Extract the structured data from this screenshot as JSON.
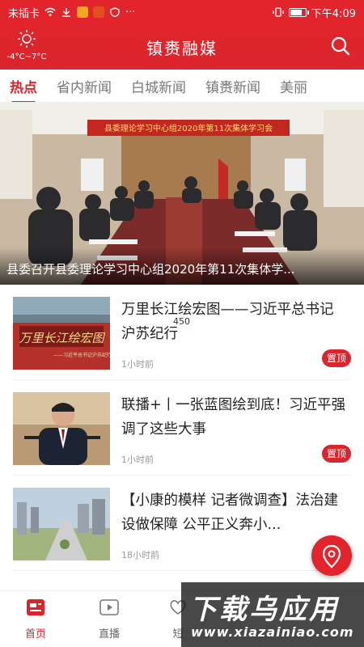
{
  "status_bar": {
    "carrier": "未插卡",
    "time": "下午4:09",
    "battery_percent": 85
  },
  "header": {
    "app_title": "镇赉融媒",
    "weather_temp": "-4°C~7°C",
    "weather_icon": "sun-icon",
    "search_icon": "search-icon"
  },
  "tabs": [
    "热点",
    "省内新闻",
    "白城新闻",
    "镇赉新闻",
    "美丽"
  ],
  "banner": {
    "caption": "县委召开县委理论学习中心组2020年第11次集体学...",
    "banner_text": "县委理论学习中心组2020年第11次集体学习会"
  },
  "articles": [
    {
      "title": "万里长江绘宏图——习近平总书记沪苏纪行",
      "time": "1小时前",
      "badge": "置顶",
      "thumb_text": "万里长江绘宏图",
      "thumb_sub": "——习近平总书记沪苏纪行"
    },
    {
      "title": "联播+丨一张蓝图绘到底！习近平强调了这些大事",
      "time": "1小时前",
      "badge": "置顶"
    },
    {
      "title": "【小康的模样 记者微调查】法治建设做保障 公平正义奔小...",
      "time": "18小时前"
    }
  ],
  "overlay_number": "450",
  "bottom_nav": [
    {
      "label": "首页",
      "icon": "news-icon"
    },
    {
      "label": "直播",
      "icon": "video-icon"
    },
    {
      "label": "短",
      "icon": "heart-icon"
    }
  ],
  "watermark": {
    "title": "下载乌应用",
    "url": "www.xiazainiao.com"
  },
  "colors": {
    "brand": "#e2252c",
    "accent": "#d9252c"
  }
}
